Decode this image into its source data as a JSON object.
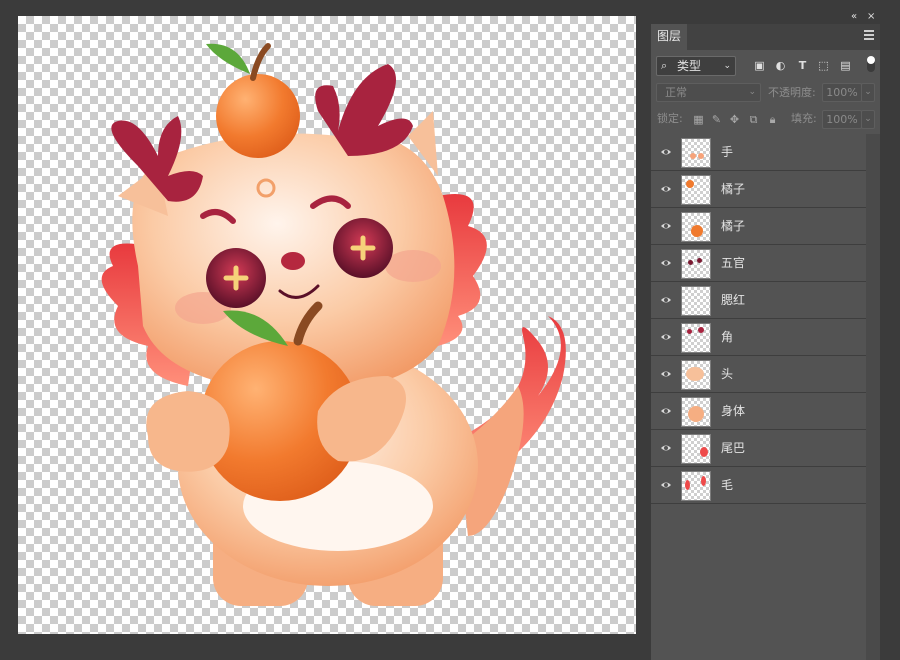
{
  "layers_panel": {
    "tab_label": "图层",
    "collapse_glyph": "«",
    "close_glyph": "×",
    "filter": {
      "value": "类型"
    },
    "filter_icons": [
      "image-filter-icon",
      "adjustment-filter-icon",
      "type-filter-icon",
      "shape-filter-icon",
      "smart-object-filter-icon"
    ],
    "blend_mode": "正常",
    "opacity_label": "不透明度:",
    "opacity_value": "100%",
    "lock_label": "锁定:",
    "fill_label": "填充:",
    "fill_value": "100%",
    "layers": [
      {
        "name": "手",
        "visible": true
      },
      {
        "name": "橘子",
        "visible": true
      },
      {
        "name": "橘子",
        "visible": true
      },
      {
        "name": "五官",
        "visible": true
      },
      {
        "name": "腮红",
        "visible": true
      },
      {
        "name": "角",
        "visible": true
      },
      {
        "name": "头",
        "visible": true
      },
      {
        "name": "身体",
        "visible": true
      },
      {
        "name": "尾巴",
        "visible": true
      },
      {
        "name": "毛",
        "visible": true
      }
    ]
  },
  "colors": {
    "app_background": "#3b3b3b",
    "panel_background": "#535353",
    "dragon_body": "#f7b98c",
    "orange": "#f07a2e",
    "horn": "#a8233f",
    "fin": "#ee4a4a"
  }
}
